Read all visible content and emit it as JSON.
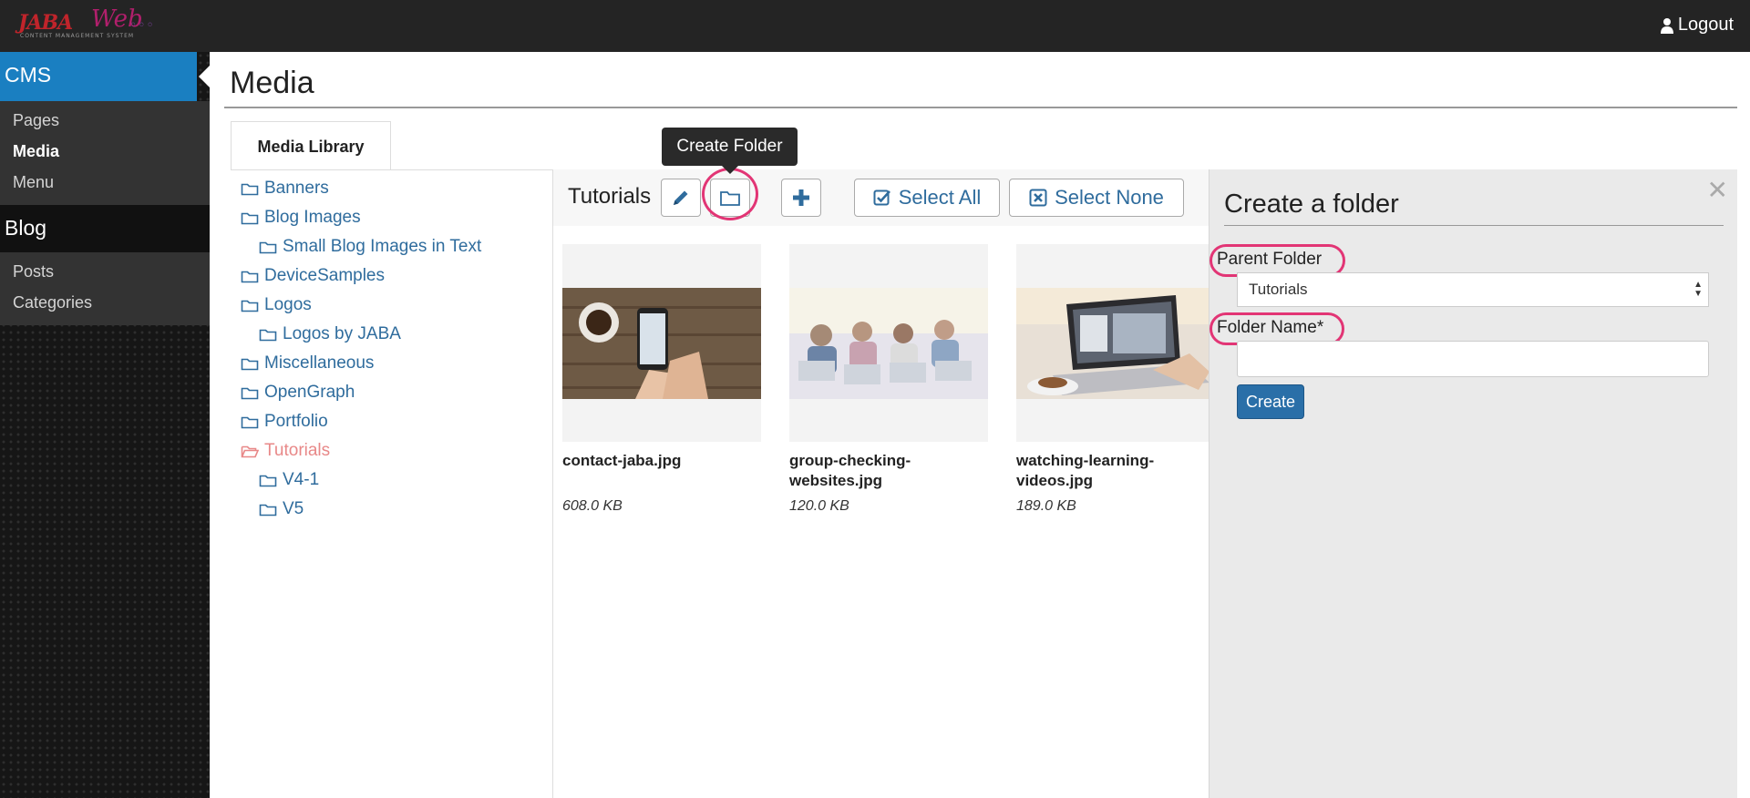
{
  "header": {
    "logo": {
      "main": "JABA",
      "signature": "Web",
      "tagline": "CONTENT MANAGEMENT SYSTEM"
    },
    "logout_label": "Logout"
  },
  "sidebar": {
    "sections": [
      {
        "label": "CMS",
        "items": [
          {
            "label": "Pages"
          },
          {
            "label": "Media",
            "active": true
          },
          {
            "label": "Menu"
          }
        ]
      },
      {
        "label": "Blog",
        "items": [
          {
            "label": "Posts"
          },
          {
            "label": "Categories"
          }
        ]
      }
    ],
    "accent_color": "#1a7fc1"
  },
  "page": {
    "title": "Media"
  },
  "tabs": [
    {
      "label": "Media Library",
      "active": true
    }
  ],
  "tree": [
    {
      "label": "Banners",
      "level": 0
    },
    {
      "label": "Blog Images",
      "level": 0
    },
    {
      "label": "Small Blog Images in Text",
      "level": 1
    },
    {
      "label": "DeviceSamples",
      "level": 0
    },
    {
      "label": "Logos",
      "level": 0
    },
    {
      "label": "Logos by JABA",
      "level": 1
    },
    {
      "label": "Miscellaneous",
      "level": 0
    },
    {
      "label": "OpenGraph",
      "level": 0
    },
    {
      "label": "Portfolio",
      "level": 0
    },
    {
      "label": "Tutorials",
      "level": 0,
      "active": true
    },
    {
      "label": "V4-1",
      "level": 1
    },
    {
      "label": "V5",
      "level": 1
    }
  ],
  "toolbar": {
    "current_folder": "Tutorials",
    "select_all_label": "Select All",
    "select_none_label": "Select None",
    "tooltip": "Create Folder",
    "icons": {
      "edit": "pencil-icon",
      "folder": "folder-icon",
      "add": "plus-icon"
    }
  },
  "media": [
    {
      "name": "contact-jaba.jpg",
      "size": "608.0 KB"
    },
    {
      "name": "group-checking-websites.jpg",
      "size": "120.0 KB"
    },
    {
      "name": "watching-learning-videos.jpg",
      "size": "189.0 KB"
    }
  ],
  "create_folder": {
    "title": "Create a folder",
    "parent_label": "Parent Folder",
    "parent_value": "Tutorials",
    "name_label": "Folder Name*",
    "name_value": "",
    "create_label": "Create",
    "close_icon": "close-icon"
  },
  "colors": {
    "annotation": "#e23575",
    "link": "#2f6c9d",
    "active_tree": "#e88888",
    "button": "#2a6fa8"
  }
}
